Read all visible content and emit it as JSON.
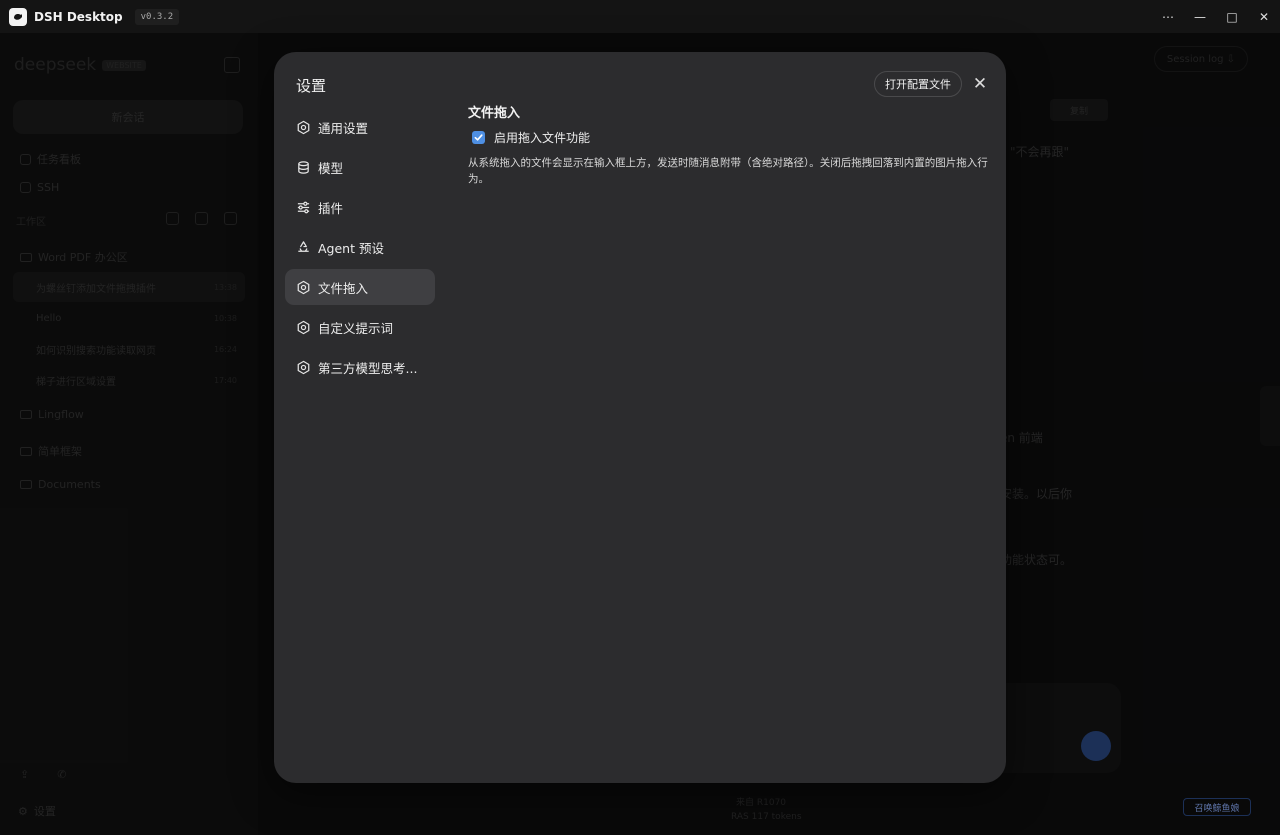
{
  "window": {
    "app_title": "DSH Desktop",
    "version": "v0.3.2",
    "controls": {
      "more": "⋯",
      "minimize": "—",
      "maximize": "□",
      "close": "✕"
    }
  },
  "sidebar": {
    "brand": "deepseek",
    "brand_badge": "WEBSITE",
    "new_chat": "新会话",
    "items": [
      {
        "label": "任务看板"
      },
      {
        "label": "SSH"
      }
    ],
    "workspace_label": "工作区",
    "workspace_group": "Word PDF 办公区",
    "conversations": [
      {
        "title": "为螺丝钉添加文件拖拽插件",
        "time": "13:38"
      },
      {
        "title": "Hello",
        "time": "10:38"
      },
      {
        "title": "如何识别搜索功能读取网页",
        "time": "16:24"
      },
      {
        "title": "梯子进行区域设置",
        "time": "17:40"
      }
    ],
    "folders": [
      {
        "label": "Lingflow"
      },
      {
        "label": "简单框架"
      },
      {
        "label": "Documents"
      }
    ],
    "settings_label": "设置"
  },
  "main": {
    "session_log": "Session log ⇩",
    "bg_tag": "复制",
    "bg_lines": [
      {
        "text": "\"不会再跟\""
      },
      {
        "text": "en 前端"
      },
      {
        "text": "安装。以后你"
      },
      {
        "text": "功能状态可。"
      }
    ],
    "bottom_notes": [
      "来自 R1070",
      "RAS 117 tokens"
    ],
    "mascot_button": "召唤鲸鱼娘"
  },
  "settings_modal": {
    "title": "设置",
    "open_config_label": "打开配置文件",
    "close_label": "✕",
    "nav": [
      {
        "label": "通用设置",
        "icon": "gear-icon",
        "active": false
      },
      {
        "label": "模型",
        "icon": "database-icon",
        "active": false
      },
      {
        "label": "插件",
        "icon": "sliders-icon",
        "active": false
      },
      {
        "label": "Agent 预设",
        "icon": "recycle-icon",
        "active": false
      },
      {
        "label": "文件拖入",
        "icon": "gear-icon",
        "active": true
      },
      {
        "label": "自定义提示词",
        "icon": "gear-icon",
        "active": false
      },
      {
        "label": "第三方模型思考...",
        "icon": "gear-icon",
        "active": false
      }
    ],
    "section": {
      "title": "文件拖入",
      "checkbox_label": "启用拖入文件功能",
      "checked": true,
      "description": "从系统拖入的文件会显示在输入框上方，发送时随消息附带（含绝对路径）。关闭后拖拽回落到内置的图片拖入行为。"
    }
  },
  "colors": {
    "accent": "#4e8fe3",
    "modal_bg": "#2c2c2e",
    "active_nav": "#3f3f42"
  }
}
